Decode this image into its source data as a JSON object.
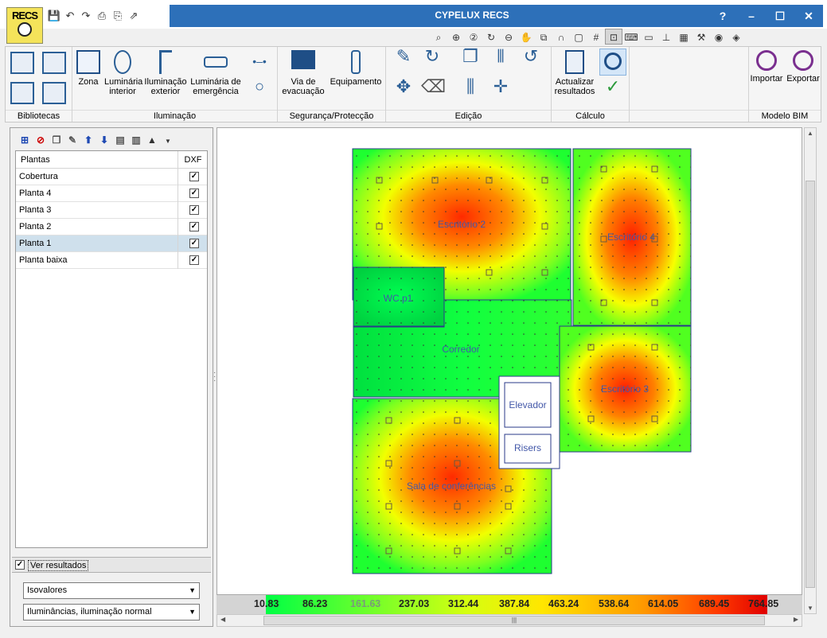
{
  "app": {
    "badge": "RECS",
    "title": "CYPELUX RECS"
  },
  "window_buttons": [
    "?",
    "–",
    "☐",
    "✕"
  ],
  "ribbon": {
    "groups": [
      {
        "label": "Bibliotecas"
      },
      {
        "label": "Iluminação",
        "buttons": [
          "Zona",
          "Luminária interior",
          "Iluminação exterior",
          "Luminária de emergência"
        ]
      },
      {
        "label": "Segurança/Protecção",
        "buttons": [
          "Via de evacuação",
          "Equipamento"
        ]
      },
      {
        "label": "Edição"
      },
      {
        "label": "Cálculo",
        "buttons": [
          "Actualizar resultados"
        ]
      },
      {
        "label": "Modelo BIM",
        "buttons": [
          "Importar",
          "Exportar"
        ]
      }
    ]
  },
  "plants_panel": {
    "columns": [
      "Plantas",
      "DXF"
    ],
    "rows": [
      {
        "name": "Cobertura",
        "dxf": true,
        "selected": false
      },
      {
        "name": "Planta 4",
        "dxf": true,
        "selected": false
      },
      {
        "name": "Planta 3",
        "dxf": true,
        "selected": false
      },
      {
        "name": "Planta 2",
        "dxf": true,
        "selected": false
      },
      {
        "name": "Planta 1",
        "dxf": true,
        "selected": true
      },
      {
        "name": "Planta baixa",
        "dxf": true,
        "selected": false
      }
    ],
    "ver_resultados": "Ver resultados",
    "ver_resultados_checked": true,
    "select1": "Isovalores",
    "select2": "Iluminâncias, iluminação normal"
  },
  "rooms": {
    "escritorio2": "Escritório 2",
    "escritorio4": "Escritório 4",
    "wc": "WC p1",
    "corredor": "Corredor",
    "escritorio3": "Escritório 3",
    "elevador": "Elevador",
    "risers": "Risers",
    "sala": "Sala de conferências"
  },
  "legend": {
    "values": [
      "10.83",
      "86.23",
      "161.63",
      "237.03",
      "312.44",
      "387.84",
      "463.24",
      "538.64",
      "614.05",
      "689.45",
      "764.85"
    ],
    "colors": {
      "low": "#00ff44",
      "mid": "#ffe600",
      "high": "#e00000"
    }
  }
}
